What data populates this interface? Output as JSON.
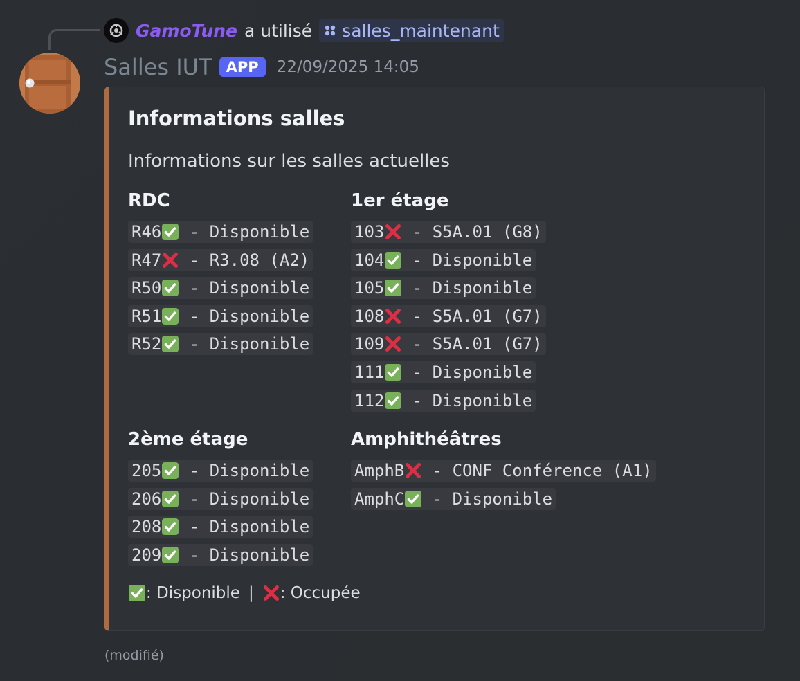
{
  "interaction": {
    "user": "GamoTune",
    "used_text": "a utilisé",
    "command": "salles_maintenant"
  },
  "bot": {
    "name": "Salles IUT",
    "badge": "APP",
    "timestamp": "22/09/2025 14:05"
  },
  "embed": {
    "accent_color": "#b06a40",
    "title": "Informations salles",
    "description": "Informations sur les salles actuelles",
    "fields": [
      {
        "name": "RDC",
        "rooms": [
          {
            "room": "R46",
            "status": "available",
            "text": "Disponible"
          },
          {
            "room": "R47",
            "status": "occupied",
            "text": "R3.08 (A2)"
          },
          {
            "room": "R50",
            "status": "available",
            "text": "Disponible"
          },
          {
            "room": "R51",
            "status": "available",
            "text": "Disponible"
          },
          {
            "room": "R52",
            "status": "available",
            "text": "Disponible"
          }
        ]
      },
      {
        "name": "1er étage",
        "rooms": [
          {
            "room": "103",
            "status": "occupied",
            "text": "S5A.01 (G8)"
          },
          {
            "room": "104",
            "status": "available",
            "text": "Disponible"
          },
          {
            "room": "105",
            "status": "available",
            "text": "Disponible"
          },
          {
            "room": "108",
            "status": "occupied",
            "text": "S5A.01 (G7)"
          },
          {
            "room": "109",
            "status": "occupied",
            "text": "S5A.01 (G7)"
          },
          {
            "room": "111",
            "status": "available",
            "text": "Disponible"
          },
          {
            "room": "112",
            "status": "available",
            "text": "Disponible"
          }
        ]
      },
      {
        "name": "2ème étage",
        "rooms": [
          {
            "room": "205",
            "status": "available",
            "text": "Disponible"
          },
          {
            "room": "206",
            "status": "available",
            "text": "Disponible"
          },
          {
            "room": "208",
            "status": "available",
            "text": "Disponible"
          },
          {
            "room": "209",
            "status": "available",
            "text": "Disponible"
          }
        ]
      },
      {
        "name": "Amphithéâtres",
        "rooms": [
          {
            "room": "AmphB",
            "status": "occupied",
            "text": "CONF Conférence (A1)"
          },
          {
            "room": "AmphC",
            "status": "available",
            "text": "Disponible"
          }
        ]
      }
    ],
    "footer": {
      "available_label": ": Disponible",
      "separator": "|",
      "occupied_label": ": Occupée"
    }
  },
  "edited_label": "(modifié)",
  "icons": {
    "available": "check-mark-button-icon",
    "occupied": "cross-mark-icon"
  },
  "colors": {
    "check_green": "#78b159",
    "cross_red": "#dd2e44",
    "username_purple": "#8a5cf0",
    "app_badge": "#5865f2"
  }
}
